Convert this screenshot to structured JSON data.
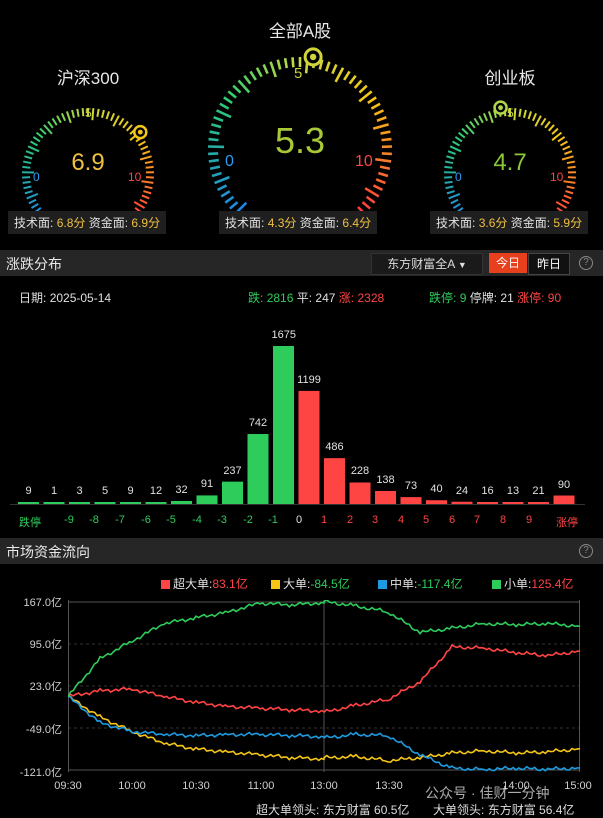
{
  "gauges": [
    {
      "title": "沪深300",
      "value": "6.9",
      "value_color": "#f0c040",
      "tech_label": "技术面:",
      "tech": "6.8分",
      "fund_label": "资金面:",
      "fund": "6.9分",
      "min": "0",
      "mid": "5",
      "max": "10",
      "level": 0.69
    },
    {
      "title": "全部A股",
      "value": "5.3",
      "value_color": "#a8c838",
      "tech_label": "技术面:",
      "tech": "4.3分",
      "fund_label": "资金面:",
      "fund": "6.4分",
      "min": "0",
      "mid": "5",
      "max": "10",
      "level": 0.53
    },
    {
      "title": "创业板",
      "value": "4.7",
      "value_color": "#8ac838",
      "tech_label": "技术面:",
      "tech": "3.6分",
      "fund_label": "资金面:",
      "fund": "5.9分",
      "min": "0",
      "mid": "5",
      "max": "10",
      "level": 0.47
    }
  ],
  "distribution": {
    "section_title": "涨跌分布",
    "dropdown": "东方财富全A",
    "tab_today": "今日",
    "tab_yesterday": "昨日",
    "help": "?",
    "date_label": "日期:",
    "date": "2025-05-14",
    "fall_label": "跌:",
    "fall": "2816",
    "flat_label": "平:",
    "flat": "247",
    "rise_label": "涨:",
    "rise": "2328",
    "limit_down_label": "跌停:",
    "limit_down": "9",
    "suspend_label": "停牌:",
    "suspend": "21",
    "limit_up_label": "涨停:",
    "limit_up": "90"
  },
  "flow": {
    "section_title": "市场资金流向",
    "help": "?",
    "legend": [
      {
        "label": "超大单:",
        "value": "83.1亿",
        "color": "#ff4444",
        "value_color": "#ff4444"
      },
      {
        "label": "大单:",
        "value": "-84.5亿",
        "color": "#f5c518",
        "value_color": "#2ecc5a"
      },
      {
        "label": "中单:",
        "value": "-117.4亿",
        "color": "#1e9be0",
        "value_color": "#2ecc5a"
      },
      {
        "label": "小单:",
        "value": "125.4亿",
        "color": "#2ecc5a",
        "value_color": "#ff4444"
      }
    ],
    "yticks": [
      "167.0亿",
      "95.0亿",
      "23.0亿",
      "-49.0亿",
      "-121.0亿"
    ],
    "xticks": [
      "09:30",
      "10:00",
      "10:30",
      "11:00",
      "13:00",
      "13:30",
      "14:00",
      "15:00"
    ],
    "footer_super_label": "超大单领头:",
    "footer_super": "东方财富 60.5亿",
    "footer_big_label": "大单领头:",
    "footer_big": "东方财富 56.4亿",
    "watermark": "公众号 · 佳财一分钟"
  },
  "chart_data": {
    "type": "bar",
    "categories": [
      "跌停",
      "-9",
      "-8",
      "-7",
      "-6",
      "-5",
      "-4",
      "-3",
      "-2",
      "-1",
      "0",
      "1",
      "2",
      "3",
      "4",
      "5",
      "6",
      "7",
      "8",
      "9",
      "涨停"
    ],
    "values": [
      9,
      1,
      3,
      5,
      9,
      12,
      32,
      91,
      237,
      742,
      1675,
      1199,
      486,
      228,
      138,
      73,
      40,
      24,
      16,
      13,
      21,
      90
    ],
    "bar_values": [
      9,
      1,
      3,
      5,
      9,
      12,
      32,
      91,
      237,
      742,
      1675,
      1199,
      486,
      228,
      138,
      73,
      40,
      24,
      16,
      13,
      21,
      90
    ],
    "colors": {
      "down": "#2ecc5a",
      "up": "#ff4444"
    },
    "flow_series": [
      {
        "name": "超大单",
        "color": "#ff4444",
        "x": [
          "09:30",
          "09:45",
          "10:00",
          "10:15",
          "10:30",
          "10:45",
          "11:00",
          "11:15",
          "11:30",
          "13:00",
          "13:15",
          "13:30",
          "13:45",
          "14:00",
          "14:15",
          "14:30",
          "14:45",
          "15:00"
        ],
        "y": [
          5,
          15,
          18,
          5,
          -5,
          -12,
          -15,
          -18,
          -20,
          -22,
          -10,
          0,
          30,
          90,
          88,
          80,
          75,
          83.1
        ]
      },
      {
        "name": "大单",
        "color": "#f5c518",
        "x": [
          "09:30",
          "09:45",
          "10:00",
          "10:15",
          "10:30",
          "10:45",
          "11:00",
          "11:15",
          "11:30",
          "13:00",
          "13:15",
          "13:30",
          "13:45",
          "14:00",
          "14:15",
          "14:30",
          "14:45",
          "15:00"
        ],
        "y": [
          5,
          -30,
          -55,
          -75,
          -85,
          -90,
          -95,
          -100,
          -102,
          -100,
          -98,
          -105,
          -100,
          -92,
          -88,
          -92,
          -90,
          -84.5
        ]
      },
      {
        "name": "中单",
        "color": "#1e9be0",
        "x": [
          "09:30",
          "09:45",
          "10:00",
          "10:15",
          "10:30",
          "10:45",
          "11:00",
          "11:15",
          "11:30",
          "13:00",
          "13:15",
          "13:30",
          "13:45",
          "14:00",
          "14:15",
          "14:30",
          "14:45",
          "15:00"
        ],
        "y": [
          5,
          -40,
          -55,
          -60,
          -62,
          -60,
          -60,
          -62,
          -64,
          -66,
          -60,
          -62,
          -95,
          -118,
          -120,
          -118,
          -120,
          -117.4
        ]
      },
      {
        "name": "小单",
        "color": "#2ecc5a",
        "x": [
          "09:30",
          "09:45",
          "10:00",
          "10:15",
          "10:30",
          "10:45",
          "11:00",
          "11:15",
          "11:30",
          "13:00",
          "13:15",
          "13:30",
          "13:45",
          "14:00",
          "14:15",
          "14:30",
          "14:45",
          "15:00"
        ],
        "y": [
          5,
          70,
          100,
          130,
          140,
          150,
          165,
          162,
          166,
          168,
          160,
          150,
          115,
          122,
          130,
          128,
          130,
          125.4
        ]
      }
    ],
    "flow_ylim": [
      -121,
      167
    ]
  }
}
